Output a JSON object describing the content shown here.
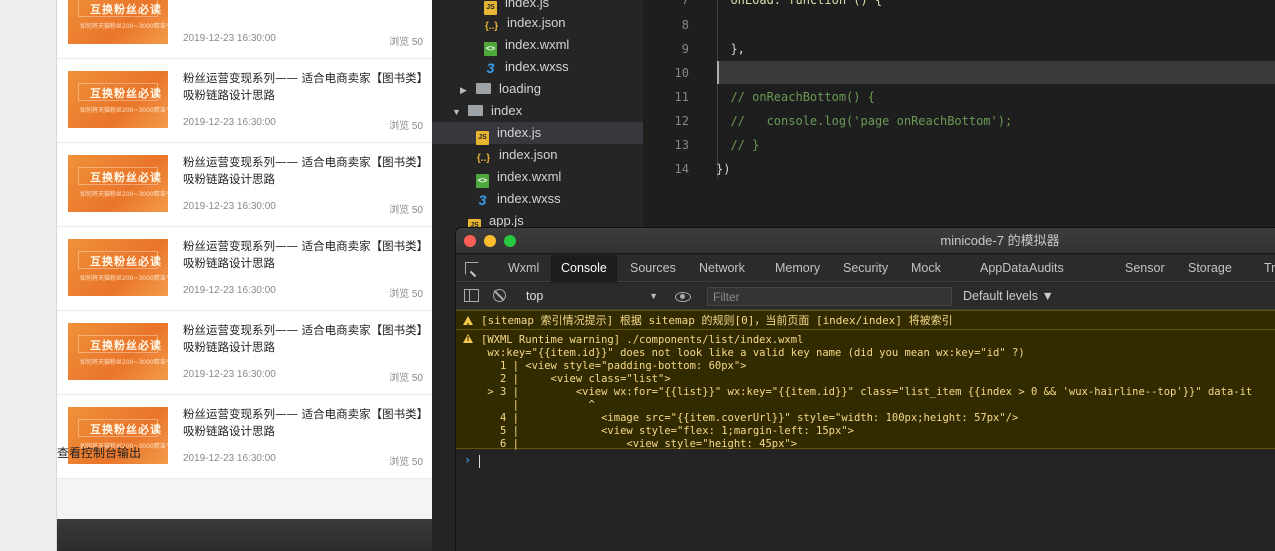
{
  "simulator": {
    "items": [
      {
        "title": "",
        "date": "2019-12-23 16:30:00",
        "views": "浏览 50",
        "thumb_title": "互换粉丝必读",
        "thumb_sub": "如何将天猫粉丝200~3000精准引流"
      },
      {
        "title": "粉丝运营变现系列—— 适合电商卖家【图书类】吸粉链路设计思路",
        "date": "2019-12-23 16:30:00",
        "views": "浏览 50",
        "thumb_title": "互换粉丝必读",
        "thumb_sub": "如何将天猫粉丝200~3000精准引流"
      },
      {
        "title": "粉丝运营变现系列—— 适合电商卖家【图书类】吸粉链路设计思路",
        "date": "2019-12-23 16:30:00",
        "views": "浏览 50",
        "thumb_title": "互换粉丝必读",
        "thumb_sub": "如何将天猫粉丝200~3000精准引流"
      },
      {
        "title": "粉丝运营变现系列—— 适合电商卖家【图书类】吸粉链路设计思路",
        "date": "2019-12-23 16:30:00",
        "views": "浏览 50",
        "thumb_title": "互换粉丝必读",
        "thumb_sub": "如何将天猫粉丝200~3000精准引流"
      },
      {
        "title": "粉丝运营变现系列—— 适合电商卖家【图书类】吸粉链路设计思路",
        "date": "2019-12-23 16:30:00",
        "views": "浏览 50",
        "thumb_title": "互换粉丝必读",
        "thumb_sub": "如何将天猫粉丝200~3000精准引流"
      },
      {
        "title": "粉丝运营变现系列—— 适合电商卖家【图书类】吸粉链路设计思路",
        "date": "2019-12-23 16:30:00",
        "views": "浏览 50",
        "thumb_title": "互换粉丝必读",
        "thumb_sub": "如何将天猫粉丝200~3000精准引流"
      }
    ],
    "console_label": "查看控制台输出"
  },
  "file_tree": {
    "nodes": [
      {
        "label": "index.js",
        "icon": "js-file-icon",
        "icon_text": "JS"
      },
      {
        "label": "index.json",
        "icon": "json-file-icon",
        "icon_text": "{..}"
      },
      {
        "label": "index.wxml",
        "icon": "wxml-file-icon",
        "icon_text": "<>"
      },
      {
        "label": "index.wxss",
        "icon": "wxss-file-icon",
        "icon_text": "3"
      },
      {
        "label": "loading",
        "icon": "folder-icon",
        "arrow": "▶"
      },
      {
        "label": "index",
        "icon": "folder-open-icon",
        "arrow": "▼"
      },
      {
        "label": "index.js",
        "icon": "js-file-icon",
        "icon_text": "JS"
      },
      {
        "label": "index.json",
        "icon": "json-file-icon",
        "icon_text": "{..}"
      },
      {
        "label": "index.wxml",
        "icon": "wxml-file-icon",
        "icon_text": "<>"
      },
      {
        "label": "index.wxss",
        "icon": "wxss-file-icon",
        "icon_text": "3"
      },
      {
        "label": "app.js",
        "icon": "js-file-icon",
        "icon_text": "JS"
      }
    ]
  },
  "editor": {
    "lines": [
      {
        "num": "7",
        "text": "  onLoad: function () {"
      },
      {
        "num": "8",
        "text": ""
      },
      {
        "num": "9",
        "text": "  },"
      },
      {
        "num": "10",
        "text": ""
      },
      {
        "num": "11",
        "text": "  // onReachBottom() {"
      },
      {
        "num": "12",
        "text": "  //   console.log('page onReachBottom');"
      },
      {
        "num": "13",
        "text": "  // }"
      },
      {
        "num": "14",
        "text": "})"
      }
    ]
  },
  "devtools": {
    "window_title": "minicode-7 的模拟器",
    "tabs": [
      "Wxml",
      "Console",
      "Sources",
      "Network",
      "Memory",
      "Security",
      "Mock",
      "AppData",
      "Audits",
      "Sensor",
      "Storage",
      "Trace"
    ],
    "active_tab": "Console",
    "context": "top",
    "filter_placeholder": "Filter",
    "levels": "Default levels ▼",
    "warning1": "[sitemap 索引情况提示] 根据 sitemap 的规则[0]，当前页面 [index/index] 将被索引",
    "warning2_lines": [
      "[WXML Runtime warning] ./components/list/index.wxml",
      " wx:key=\"{{item.id}}\" does not look like a valid key name (did you mean wx:key=\"id\" ?)",
      "   1 | <view style=\"padding-bottom: 60px\">",
      "   2 |     <view class=\"list\">",
      " > 3 |         <view wx:for=\"{{list}}\" wx:key=\"{{item.id}}\" class=\"list_item {{index > 0 && 'wux-hairline--top'}}\" data-it",
      "     |           ^",
      "   4 |             <image src=\"{{item.coverUrl}}\" style=\"width: 100px;height: 57px\"/>",
      "   5 |             <view style=\"flex: 1;margin-left: 15px\">",
      "   6 |                 <view style=\"height: 45px\">"
    ],
    "prompt": "›"
  },
  "colors": {
    "accent_orange": "#ee7d2e",
    "editor_bg": "#1e1e1e",
    "warning_bg": "#332b00",
    "warning_text": "#f5d98b"
  }
}
